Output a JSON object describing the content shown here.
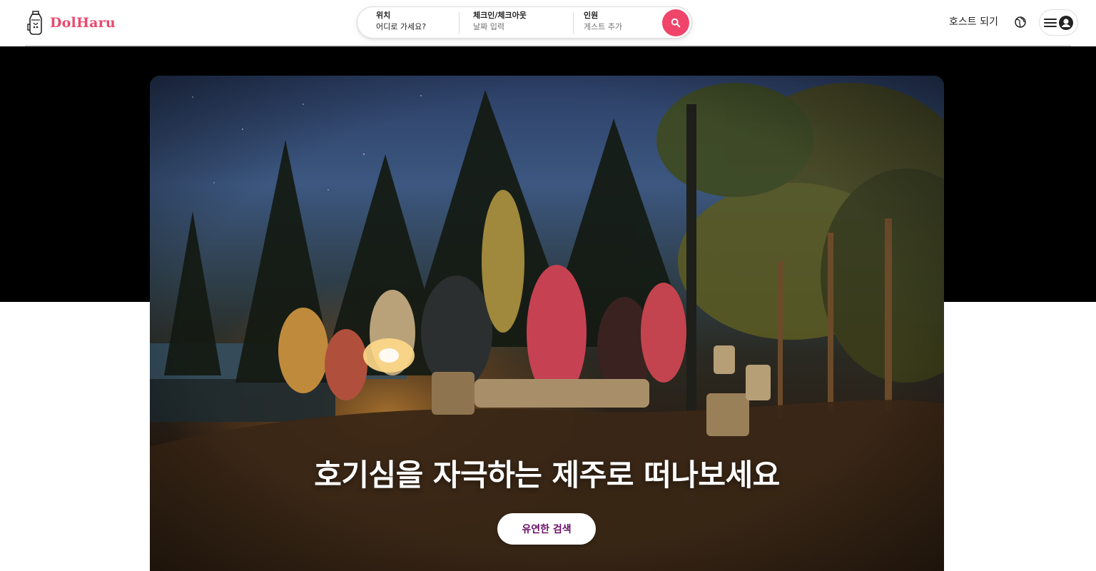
{
  "brand": {
    "name": "DolHaru",
    "color": "#e84a6e",
    "logo_icon": "lantern-jar-icon"
  },
  "search": {
    "location": {
      "label": "위치",
      "value": "어디로 가세요?"
    },
    "dates": {
      "label": "체크인/체크아웃",
      "value": "날짜 입력"
    },
    "guests": {
      "label": "인원",
      "value": "게스트 추가"
    },
    "button_icon": "search-icon",
    "button_color": "#f0446a"
  },
  "nav": {
    "host_label": "호스트 되기",
    "globe_icon": "globe-icon",
    "menu_icon": "hamburger-menu-icon",
    "avatar_icon": "user-avatar-icon"
  },
  "hero": {
    "image": "campfire-night-forest-photo",
    "title": "호기심을 자극하는 제주로 떠나보세요",
    "button_label": "유연한 검색",
    "button_text_color": "#6a0f66"
  }
}
